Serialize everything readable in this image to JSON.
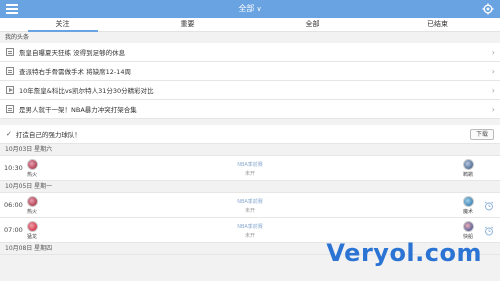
{
  "header": {
    "title": "全部",
    "accent": "#6aa3e2"
  },
  "tabs": [
    {
      "label": "关注",
      "active": true
    },
    {
      "label": "重要",
      "active": false
    },
    {
      "label": "全部",
      "active": false
    },
    {
      "label": "已结束",
      "active": false
    }
  ],
  "headlines": {
    "title": "我的头条",
    "items": [
      {
        "icon": "doc-icon",
        "text": "詹皇自曝夏天狂练 没得到足够的休息"
      },
      {
        "icon": "doc-icon",
        "text": "查派特右手骨需做手术 将缺席12-14周"
      },
      {
        "icon": "play-icon",
        "text": "10年詹皇&科比vs凯尔特人31分30分精彩对比"
      },
      {
        "icon": "doc-icon",
        "text": "是男人就干一架！NBA暴力冲突打架合集"
      }
    ]
  },
  "favorite": {
    "text": "打造自己的强力球队！",
    "button": "下载"
  },
  "schedule": [
    {
      "date": "10月03日 星期六",
      "games": [
        {
          "time": "10:30",
          "home": "热火",
          "away": "鹈鹕",
          "league": "NBA季前赛",
          "status": "未开",
          "home_color": "#9b1b30",
          "away_color": "#2b4a7a"
        }
      ]
    },
    {
      "date": "10月05日 星期一",
      "games": [
        {
          "time": "06:00",
          "home": "热火",
          "away": "魔术",
          "league": "NBA季前赛",
          "status": "未开",
          "home_color": "#9b1b30",
          "away_color": "#1e6aa8"
        },
        {
          "time": "07:00",
          "home": "猛龙",
          "away": "快船",
          "league": "NBA季前赛",
          "status": "未开",
          "home_color": "#c8102e",
          "away_color": "#1d428a"
        }
      ]
    },
    {
      "date": "10月08日 星期四",
      "games": []
    }
  ],
  "watermark": "Veryol.com"
}
